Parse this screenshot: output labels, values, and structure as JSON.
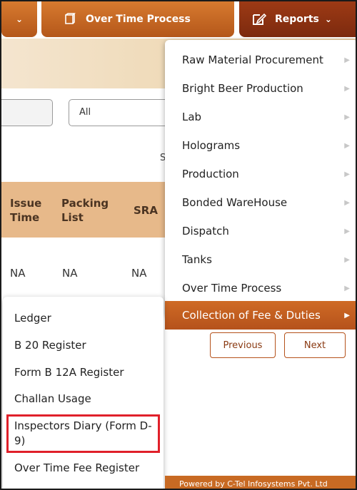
{
  "nav": {
    "left_chevron": "⌄",
    "overtime_label": "Over Time Process",
    "reports_label": "Reports",
    "reports_chevron": "⌄"
  },
  "filters": {
    "select_value": "All",
    "partial_letter": "S"
  },
  "table": {
    "headers": [
      {
        "line1": "Issue",
        "line2": "Time"
      },
      {
        "line1": "Packing",
        "line2": "List"
      },
      {
        "line1": "SRA",
        "line2": ""
      }
    ],
    "row": [
      "NA",
      "NA",
      "NA"
    ]
  },
  "reports_menu": {
    "items": [
      {
        "label": "Raw Material Procurement"
      },
      {
        "label": "Bright Beer Production"
      },
      {
        "label": "Lab"
      },
      {
        "label": "Holograms"
      },
      {
        "label": "Production"
      },
      {
        "label": "Bonded WareHouse"
      },
      {
        "label": "Dispatch"
      },
      {
        "label": "Tanks"
      },
      {
        "label": "Over Time Process"
      },
      {
        "label": "Collection of Fee & Duties"
      }
    ],
    "arrow": "▶"
  },
  "submenu": {
    "items": [
      {
        "label": "Ledger"
      },
      {
        "label": "B 20 Register"
      },
      {
        "label": "Form B 12A Register"
      },
      {
        "label": "Challan Usage"
      },
      {
        "label": "Inspectors Diary (Form D-9)"
      },
      {
        "label": "Over Time Fee Register"
      }
    ]
  },
  "pagination": {
    "previous": "Previous",
    "next": "Next"
  },
  "footer": {
    "text": "Powered by C-Tel Infosystems Pvt. Ltd"
  },
  "colors": {
    "nav_orange": "#c86a23",
    "reports_dark": "#8a3112",
    "table_header": "#e7b98a",
    "highlight_red": "#e0202a"
  }
}
